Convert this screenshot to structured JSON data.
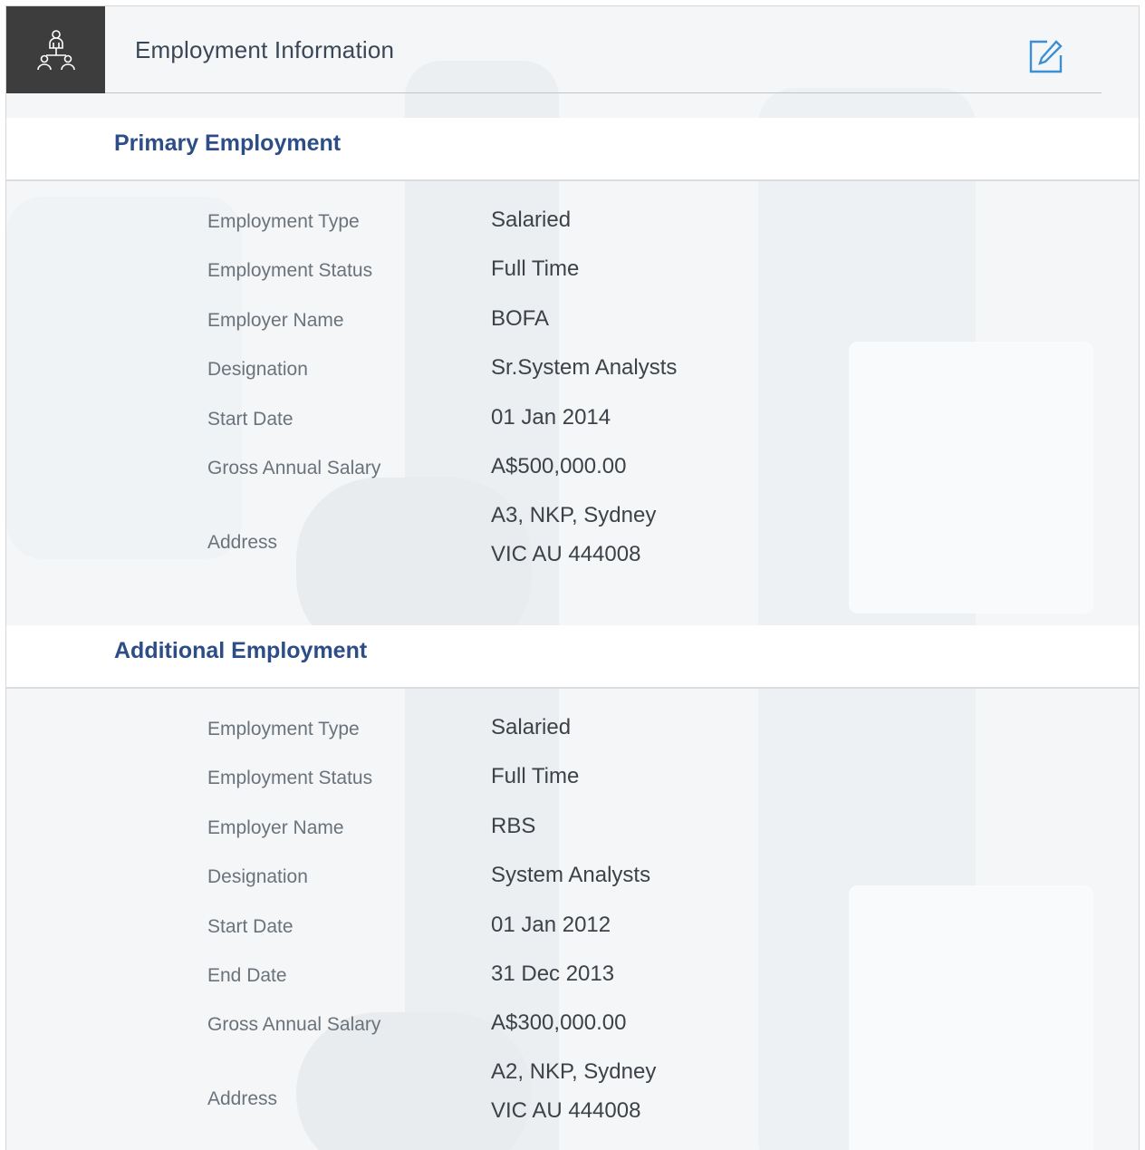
{
  "header": {
    "title": "Employment Information",
    "icon": "org-chart-icon",
    "edit_icon": "edit-icon"
  },
  "colors": {
    "icon_box": "#3d3d3d",
    "section_title": "#2d4d86",
    "accent": "#3a8fd6"
  },
  "primary": {
    "title": "Primary Employment",
    "fields": [
      {
        "label": "Employment Type",
        "value": "Salaried"
      },
      {
        "label": "Employment Status",
        "value": "Full Time"
      },
      {
        "label": "Employer Name",
        "value": "BOFA"
      },
      {
        "label": "Designation",
        "value": "Sr.System Analysts"
      },
      {
        "label": "Start Date",
        "value": "01 Jan 2014"
      },
      {
        "label": "Gross Annual Salary",
        "value": "A$500,000.00"
      }
    ],
    "address": {
      "label": "Address",
      "line1": "A3, NKP, Sydney",
      "line2": "VIC AU 444008"
    }
  },
  "additional": {
    "title": "Additional Employment",
    "fields": [
      {
        "label": "Employment Type",
        "value": "Salaried"
      },
      {
        "label": "Employment Status",
        "value": "Full Time"
      },
      {
        "label": "Employer Name",
        "value": "RBS"
      },
      {
        "label": "Designation",
        "value": "System Analysts"
      },
      {
        "label": "Start Date",
        "value": "01 Jan 2012"
      },
      {
        "label": "End Date",
        "value": "31 Dec 2013"
      },
      {
        "label": "Gross Annual Salary",
        "value": "A$300,000.00"
      }
    ],
    "address": {
      "label": "Address",
      "line1": "A2, NKP, Sydney",
      "line2": "VIC AU 444008"
    }
  }
}
